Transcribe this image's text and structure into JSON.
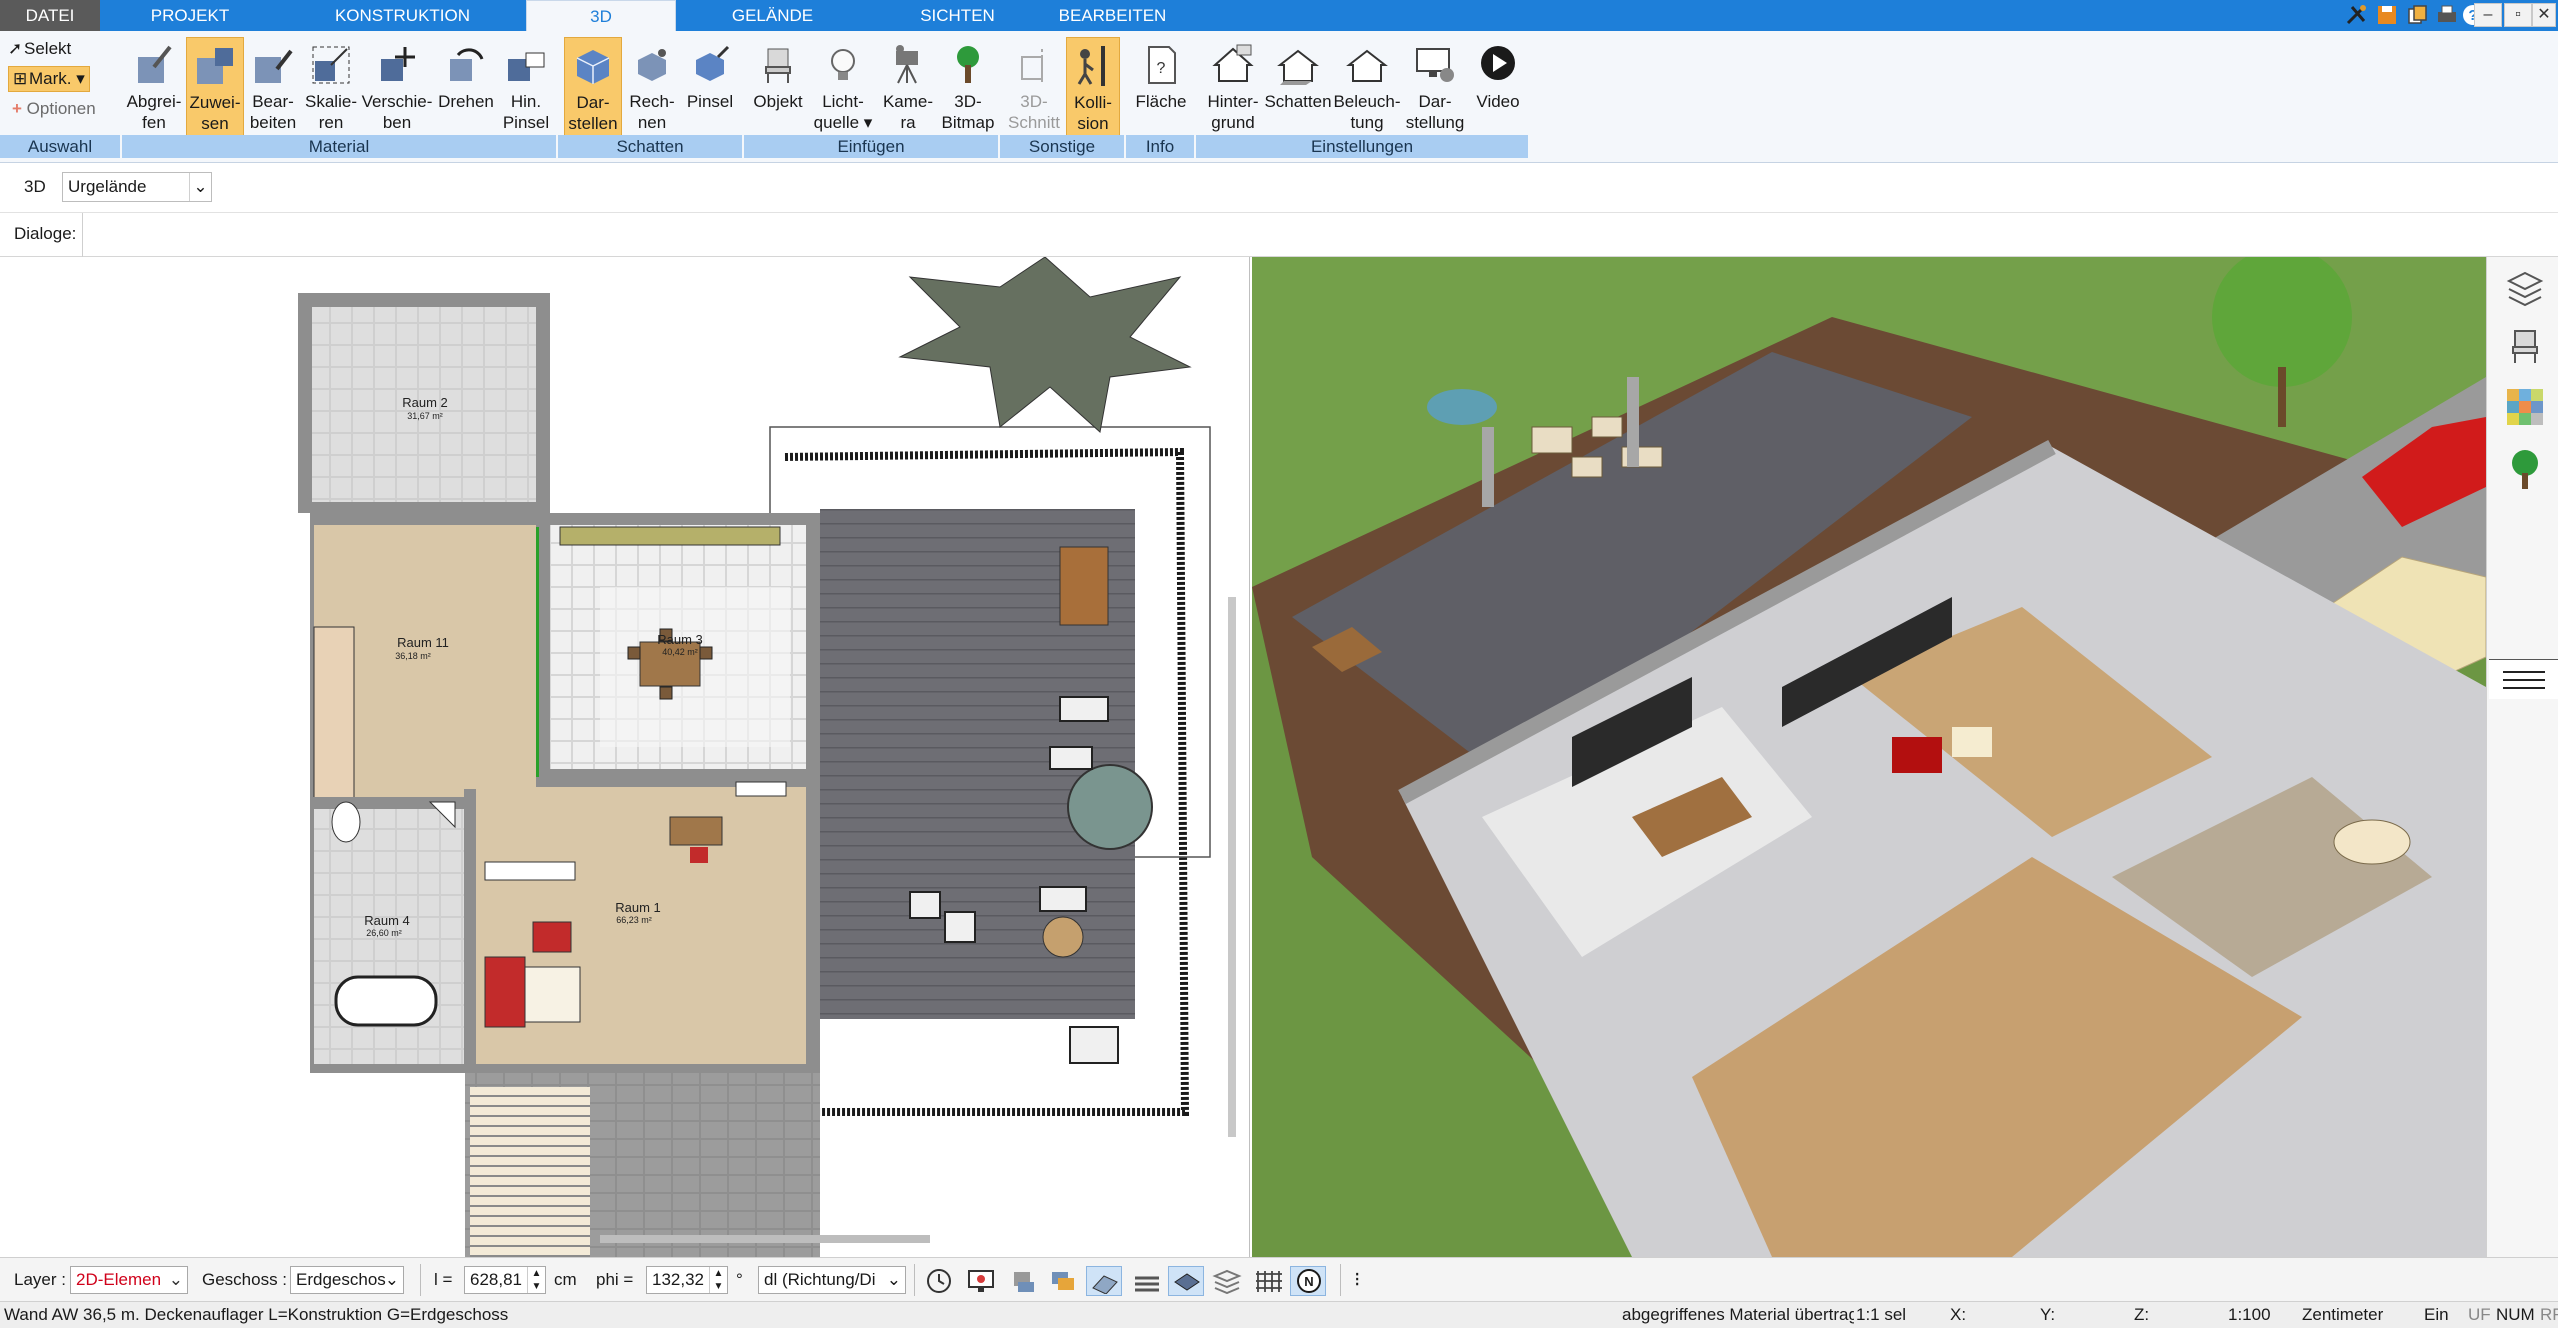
{
  "tabs": [
    {
      "label": "DATEI"
    },
    {
      "label": "PROJEKT"
    },
    {
      "label": "KONSTRUKTION"
    },
    {
      "label": "3D"
    },
    {
      "label": "GELÄNDE"
    },
    {
      "label": "SICHTEN"
    },
    {
      "label": "BEARBEITEN"
    }
  ],
  "ribbon": {
    "selection": {
      "selekt": "Selekt",
      "mark": "Mark.",
      "optionen": "Optionen"
    },
    "buttons": [
      {
        "line1": "Abgrei-",
        "line2": "fen"
      },
      {
        "line1": "Zuwei-",
        "line2": "sen"
      },
      {
        "line1": "Bear-",
        "line2": "beiten"
      },
      {
        "line1": "Skalie-",
        "line2": "ren"
      },
      {
        "line1": "Verschie-",
        "line2": "ben"
      },
      {
        "line1": "Drehen",
        "line2": ""
      },
      {
        "line1": "Hin.",
        "line2": "Pinsel"
      },
      {
        "line1": "Dar-",
        "line2": "stellen"
      },
      {
        "line1": "Rech-",
        "line2": "nen"
      },
      {
        "line1": "Pinsel",
        "line2": ""
      },
      {
        "line1": "Objekt",
        "line2": ""
      },
      {
        "line1": "Licht-",
        "line2": "quelle"
      },
      {
        "line1": "Kame-",
        "line2": "ra"
      },
      {
        "line1": "3D-",
        "line2": "Bitmap"
      },
      {
        "line1": "3D-",
        "line2": "Schnitt"
      },
      {
        "line1": "Kolli-",
        "line2": "sion"
      },
      {
        "line1": "Fläche",
        "line2": ""
      },
      {
        "line1": "Hinter-",
        "line2": "grund"
      },
      {
        "line1": "Schatten",
        "line2": ""
      },
      {
        "line1": "Beleuch-",
        "line2": "tung"
      },
      {
        "line1": "Dar-",
        "line2": "stellung"
      },
      {
        "line1": "Video",
        "line2": ""
      }
    ],
    "groups": [
      "Auswahl",
      "Material",
      "Schatten",
      "Einfügen",
      "Sonstige",
      "Info",
      "Einstellungen"
    ]
  },
  "toolbar": {
    "mode": "3D",
    "terrain_select": "Urgelände",
    "dialogs_label": "Dialoge:"
  },
  "plan": {
    "rooms": [
      {
        "name": "Raum 2",
        "area": "31,67 m²"
      },
      {
        "name": "Raum 11",
        "area": "36,18 m²"
      },
      {
        "name": "Raum 3",
        "area": "40,42 m²"
      },
      {
        "name": "Raum 4",
        "area": "26,60 m²"
      },
      {
        "name": "Raum 1",
        "area": "66,23 m²"
      }
    ]
  },
  "bottom": {
    "layer_label": "Layer :",
    "layer_value": "2D-Elemen",
    "geschoss_label": "Geschoss :",
    "geschoss_value": "Erdgeschos",
    "l_label": "l =",
    "l_value": "628,81",
    "l_unit": "cm",
    "phi_label": "phi =",
    "phi_value": "132,32",
    "phi_unit": "°",
    "dl_value": "dl (Richtung/Di"
  },
  "status": {
    "message": "Wand AW 36,5 m. Deckenauflager L=Konstruktion G=Erdgeschoss",
    "hint": "abgegriffenes Material übertrage",
    "scale_sel": "1:1 sel",
    "x": "X:",
    "y": "Y:",
    "z": "Z:",
    "scale": "1:100",
    "unit": "Zentimeter",
    "mode": "Ein",
    "uf": "UF",
    "num": "NUM",
    "rf": "RF"
  },
  "colors": {
    "accent": "#1e7fd9",
    "selected": "#f9c96a",
    "group_bar": "#a9cdf2",
    "layer_text": "#d0021b"
  }
}
